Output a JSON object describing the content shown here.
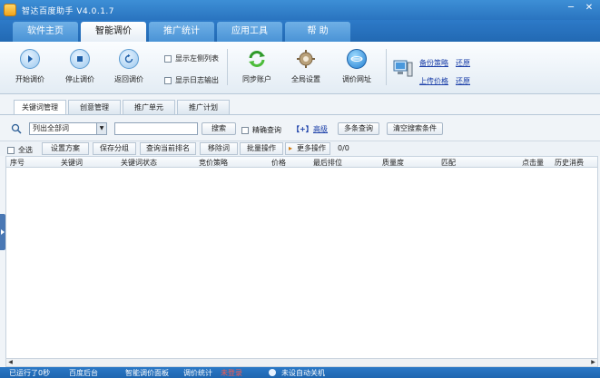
{
  "app": {
    "title": "智达百度助手 V4.0.1.7"
  },
  "main_tabs": [
    {
      "label": "软件主页"
    },
    {
      "label": "智能调价"
    },
    {
      "label": "推广统计"
    },
    {
      "label": "应用工具"
    },
    {
      "label": "帮 助"
    }
  ],
  "toolbar": {
    "start": "开始调价",
    "stop": "停止调价",
    "back": "返回调价",
    "show_left_list": "显示左侧列表",
    "show_log": "显示日志输出",
    "sync": "同步账户",
    "global_settings": "全局设置",
    "bid_url": "调价网址",
    "backup_strategy": "备份策略",
    "upload_price": "上传价格",
    "restore1": "还原",
    "restore2": "还原"
  },
  "sub_tabs": [
    {
      "label": "关键词管理"
    },
    {
      "label": "创意管理"
    },
    {
      "label": "推广单元"
    },
    {
      "label": "推广计划"
    }
  ],
  "search": {
    "select_value": "列出全部词",
    "search_btn": "搜索",
    "exact_query": "精确查询",
    "plus": "【+】",
    "advanced": "高级",
    "multi_query": "多条查询",
    "clear": "清空搜索条件"
  },
  "actions": {
    "select_all": "全选",
    "set_plan": "设置方案",
    "save_group": "保存分组",
    "query_rank": "查询当前排名",
    "remove_word": "移除词",
    "batch_ops": "批量操作",
    "more_ops": "更多操作",
    "count": "0/0"
  },
  "table": {
    "columns": [
      "序号",
      "关键词",
      "关键词状态",
      "竞价策略",
      "价格",
      "最后排位",
      "质量度",
      "匹配",
      "点击量",
      "历史消费"
    ]
  },
  "status": {
    "running": "已运行了0秒",
    "baidu_backend": "百度后台",
    "panel": "智能调价面板",
    "bid_stats": "调价统计",
    "not_logged": "未登录",
    "auto_shutdown": "未设自动关机"
  }
}
